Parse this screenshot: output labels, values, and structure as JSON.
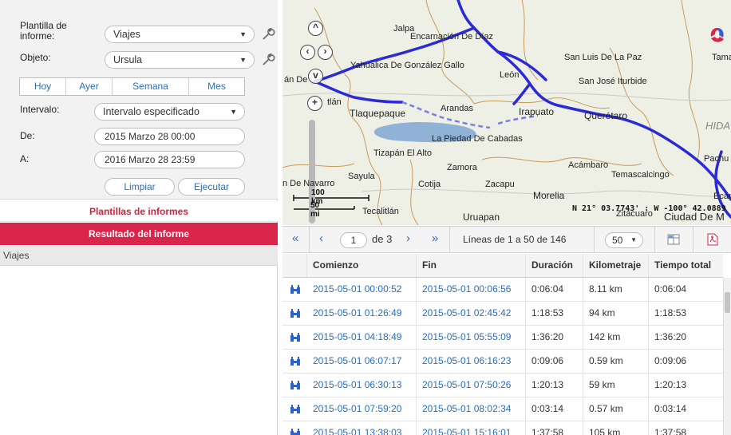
{
  "form": {
    "template_label": "Plantilla de informe:",
    "template_value": "Viajes",
    "object_label": "Objeto:",
    "object_value": "Ursula",
    "periods": [
      "Hoy",
      "Ayer",
      "Semana",
      "Mes"
    ],
    "interval_label": "Intervalo:",
    "interval_value": "Intervalo especificado",
    "from_label": "De:",
    "from_value": "2015 Marzo 28 00:00",
    "to_label": "A:",
    "to_value": "2016 Marzo 28 23:59",
    "clear_label": "Limpiar",
    "run_label": "Ejecutar"
  },
  "sections": {
    "templates": "Plantillas de informes",
    "result": "Resultado del informe",
    "result_item": "Viajes"
  },
  "map": {
    "labels": [
      "Jalpa",
      "Encarnación De Díaz",
      "San Luis De La Paz",
      "Tama",
      "Yahualica De González Gallo",
      "León",
      "San José Iturbide",
      "án De",
      "tlán",
      "Tlaquepaque",
      "Arandas",
      "Irapuato",
      "Querétaro",
      "HIDA",
      "La Piedad De Cabadas",
      "Tizapán El Alto",
      "Zamora",
      "Acámbaro",
      "Pachu",
      "Temascalcingo",
      "Sayula",
      "Cotija",
      "Zacapu",
      "n De Navarro",
      "Morelia",
      "Tecalitlán",
      "Uruapan",
      "Zitácuaro",
      "Ciudad De M",
      "Écan"
    ],
    "scale_km": "100 km",
    "scale_mi": "50 mi",
    "coords": "N 21° 03.7743' : W -100° 42.0889",
    "route_color": "#2b2bd6"
  },
  "toolbar": {
    "first": "«",
    "prev": "‹",
    "page": "1",
    "of_pages": "de 3",
    "next": "›",
    "last": "»",
    "lines_info": "Líneas de 1 a 50 de 146",
    "rows_per_page": "50"
  },
  "table": {
    "columns": [
      "Comienzo",
      "Fin",
      "Duración",
      "Kilometraje",
      "Tiempo total"
    ],
    "rows": [
      [
        "2015-05-01 00:00:52",
        "2015-05-01 00:06:56",
        "0:06:04",
        "8.11 km",
        "0:06:04"
      ],
      [
        "2015-05-01 01:26:49",
        "2015-05-01 02:45:42",
        "1:18:53",
        "94 km",
        "1:18:53"
      ],
      [
        "2015-05-01 04:18:49",
        "2015-05-01 05:55:09",
        "1:36:20",
        "142 km",
        "1:36:20"
      ],
      [
        "2015-05-01 06:07:17",
        "2015-05-01 06:16:23",
        "0:09:06",
        "0.59 km",
        "0:09:06"
      ],
      [
        "2015-05-01 06:30:13",
        "2015-05-01 07:50:26",
        "1:20:13",
        "59 km",
        "1:20:13"
      ],
      [
        "2015-05-01 07:59:20",
        "2015-05-01 08:02:34",
        "0:03:14",
        "0.57 km",
        "0:03:14"
      ],
      [
        "2015-05-01 13:38:03",
        "2015-05-01 15:16:01",
        "1:37:58",
        "105 km",
        "1:37:58"
      ]
    ]
  },
  "colors": {
    "accent": "#d9254a",
    "link": "#2a6ebb"
  }
}
